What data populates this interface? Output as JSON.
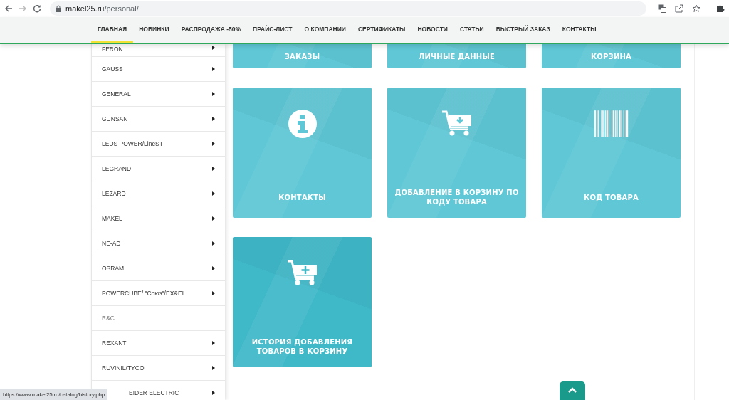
{
  "browser": {
    "url_host": "makel25.ru",
    "url_path": "/personal/"
  },
  "nav": [
    {
      "label": "ГЛАВНАЯ",
      "selected": true
    },
    {
      "label": "НОВИНКИ",
      "selected": false
    },
    {
      "label": "РАСПРОДАЖА -50%",
      "selected": false
    },
    {
      "label": "ПРАЙС-ЛИСТ",
      "selected": false
    },
    {
      "label": "О КОМПАНИИ",
      "selected": false
    },
    {
      "label": "СЕРТИФИКАТЫ",
      "selected": false
    },
    {
      "label": "НОВОСТИ",
      "selected": false
    },
    {
      "label": "СТАТЬИ",
      "selected": false
    },
    {
      "label": "БЫСТРЫЙ ЗАКАЗ",
      "selected": false
    },
    {
      "label": "КОНТАКТЫ",
      "selected": false
    }
  ],
  "sidebar": {
    "items": [
      {
        "label": "FERON",
        "has_submenu": true
      },
      {
        "label": "GAUSS",
        "has_submenu": true
      },
      {
        "label": "GENERAL",
        "has_submenu": true
      },
      {
        "label": "GUNSAN",
        "has_submenu": true
      },
      {
        "label": "LEDS POWER/LineST",
        "has_submenu": true
      },
      {
        "label": "LEGRAND",
        "has_submenu": true
      },
      {
        "label": "LEZARD",
        "has_submenu": true
      },
      {
        "label": "MAKEL",
        "has_submenu": true
      },
      {
        "label": "NE-AD",
        "has_submenu": true
      },
      {
        "label": "OSRAM",
        "has_submenu": true
      },
      {
        "label": "POWERCUBE/ \"Союз\"/EX&EL",
        "has_submenu": true
      },
      {
        "label": "R&C",
        "has_submenu": false
      },
      {
        "label": "REXANT",
        "has_submenu": true
      },
      {
        "label": "RUVINIL/TYCO",
        "has_submenu": true
      },
      {
        "label": "EIDER ELECTRIC",
        "has_submenu": true,
        "partly_hidden": true
      }
    ]
  },
  "tiles_top": [
    {
      "label": "ЗАКАЗЫ"
    },
    {
      "label": "ЛИЧНЫЕ ДАННЫЕ"
    },
    {
      "label": "КОРЗИНА"
    }
  ],
  "tiles": [
    {
      "label": "КОНТАКТЫ",
      "kind": "info"
    },
    {
      "label": "ДОБАВЛЕНИЕ В КОРЗИНУ ПО КОДУ ТОВАРА",
      "kind": "cart-down"
    },
    {
      "label": "КОД ТОВАРА",
      "kind": "barcode"
    },
    {
      "label": "ИСТОРИЯ ДОБАВЛЕНИЯ ТОВАРОВ В КОРЗИНУ",
      "kind": "cart-plus"
    }
  ],
  "status_url": "https://www.makel25.ru/catalog/history.php"
}
